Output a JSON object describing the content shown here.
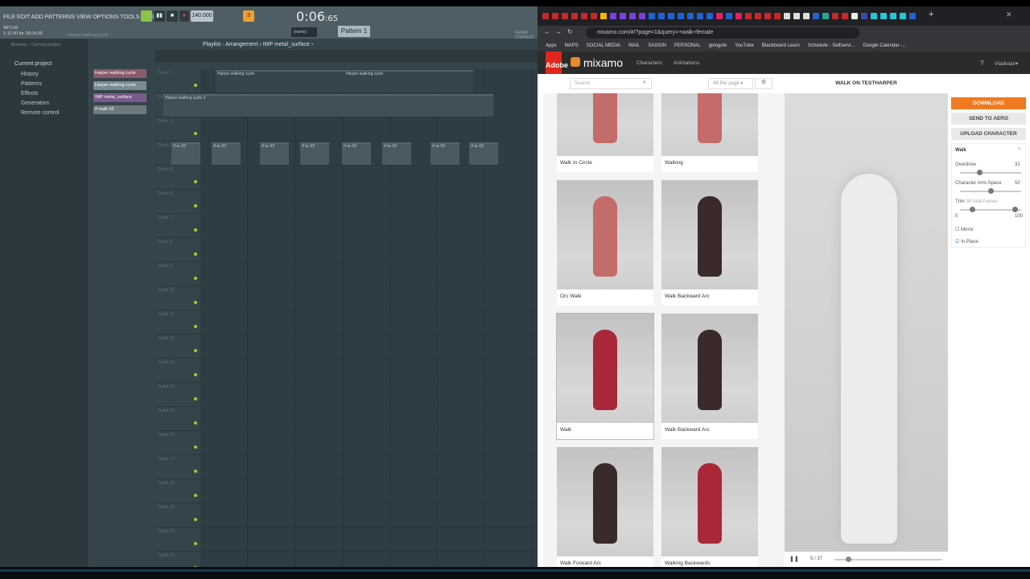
{
  "fl": {
    "menu": "FILE EDIT ADD PATTERNS VIEW OPTIONS TOOLS HELP",
    "tempo": "140.000",
    "time": "0:06",
    "time_ms": ":65",
    "pattern": "Pattern 1",
    "snap": "(none)",
    "info_id": "487143",
    "info_time": "1:11:00 for 18:04:00",
    "hint": "Harper walking cycle",
    "remix": "REMIX CONTEST",
    "browser_title": "Browser - Current project",
    "browser_items": [
      "Current project",
      "History",
      "Patterns",
      "Effects",
      "Generators",
      "Remote control"
    ],
    "playlist_title": "Playlist - Arrangement › IMP metal_surface ›",
    "channels": [
      "Harper walking cycle",
      "Harper walking cycle",
      "IMP metal_surface",
      "rf walk 02"
    ],
    "tracks": [
      "Track 1",
      "Track 2",
      "Track 3",
      "Track 4",
      "Track 5",
      "Track 6",
      "Track 7",
      "Track 8",
      "Track 9",
      "Track 10",
      "Track 11",
      "Track 12",
      "Track 13",
      "Track 14",
      "Track 15",
      "Track 16",
      "Track 17",
      "Track 18",
      "Track 19",
      "Track 20",
      "Track 21"
    ],
    "clip_t1": "Harper walking cycle",
    "clip_t2": "Harper walking cycle 3",
    "clip_t4": "rf w..02"
  },
  "chrome": {
    "url": "mixamo.com/#/?page=1&query=+walk+female",
    "bookmarks": [
      "Apps",
      "MAPS",
      "SOCIAL MEDIA",
      "MAIL",
      "SAXION",
      "PERSONAL",
      "gologolo",
      "YouTube",
      "Blackboard Learn",
      "Schedule - Selfservi...",
      "Google Calendar -..."
    ]
  },
  "mixamo": {
    "logo": "mixamo",
    "adobe": "Adobe",
    "nav": [
      "Characters",
      "Animations"
    ],
    "user": "Vladislav",
    "search_placeholder": "Search",
    "per_page": "48 Per page",
    "preview_title": "WALK ON TESTHARPER",
    "cards": [
      {
        "name": "Walk In Circle",
        "color": "#c46b6b"
      },
      {
        "name": "Walking",
        "color": "#c46b6b"
      },
      {
        "name": "Orc Walk",
        "color": "#c46b6b"
      },
      {
        "name": "Walk Backward Arc",
        "color": "#3a2a2a"
      },
      {
        "name": "Walk",
        "color": "#a8283a"
      },
      {
        "name": "Walk Backward Arc",
        "color": "#3a2a2a"
      },
      {
        "name": "Walk Forward Arc",
        "color": "#3a2a2a"
      },
      {
        "name": "Walking Backwards",
        "color": "#a8283a"
      }
    ],
    "download": "DOWNLOAD",
    "send": "SEND TO AERO",
    "upload": "UPLOAD CHARACTER",
    "panel_title": "Walk",
    "overdrive_label": "Overdrive",
    "overdrive": 32,
    "armspace_label": "Character Arm-Space",
    "armspace": 50,
    "trim_label": "Trim",
    "trim_frames": "38 total frames",
    "trim_min": "0",
    "trim_max": "100",
    "trim_range": [
      20,
      90
    ],
    "mirror": "Mirror",
    "inplace": "In Place",
    "frame": "5 / 37",
    "frame_progress": 0.13,
    "accent": "#f07a21"
  }
}
